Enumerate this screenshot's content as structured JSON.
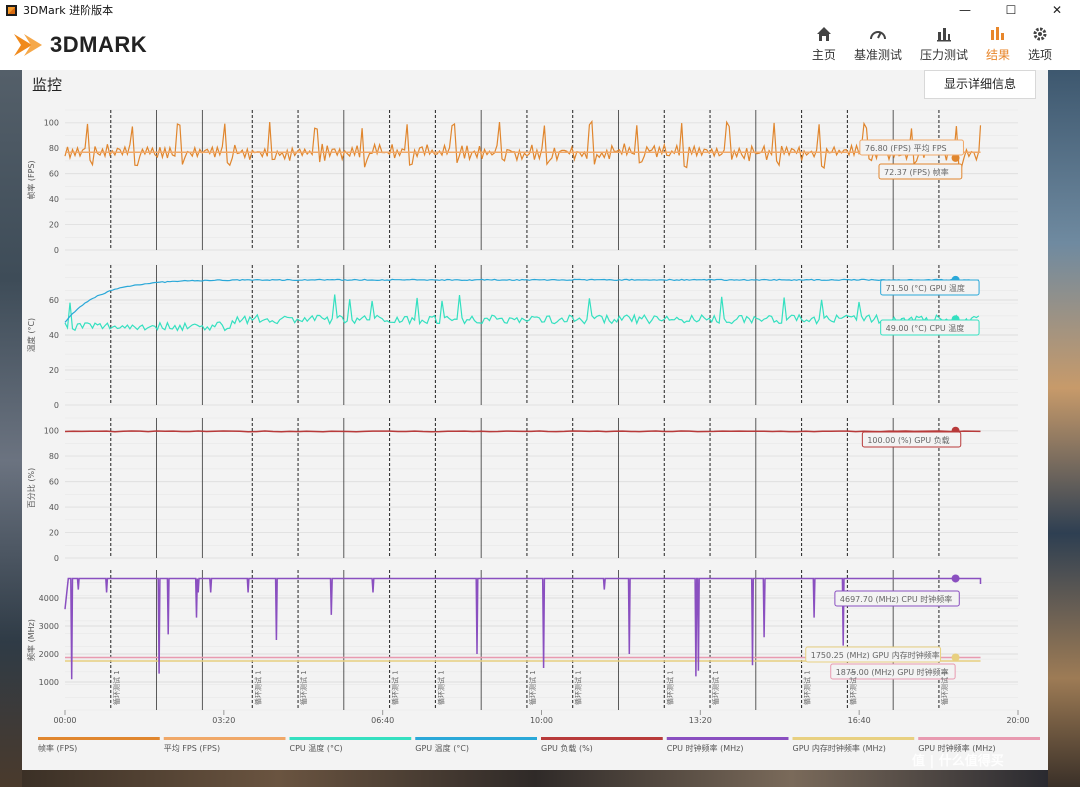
{
  "window": {
    "title": "3DMark 进阶版本",
    "controls": {
      "minimize": "—",
      "maximize": "☐",
      "close": "✕"
    }
  },
  "header": {
    "logo_text": "3DMARK",
    "nav": [
      {
        "label": "主页",
        "icon": "home-icon",
        "active": false
      },
      {
        "label": "基准测试",
        "icon": "gauge-icon",
        "active": false
      },
      {
        "label": "压力测试",
        "icon": "bar-chart-icon",
        "active": false
      },
      {
        "label": "结果",
        "icon": "results-icon",
        "active": true
      },
      {
        "label": "选项",
        "icon": "gear-icon",
        "active": false
      }
    ]
  },
  "monitor": {
    "title": "监控",
    "detail_button": "显示详细信息",
    "loop_marker_label": "循环测试 1",
    "time_ticks": [
      "00:00",
      "03:20",
      "06:40",
      "10:00",
      "13:20",
      "16:40",
      "20:00"
    ]
  },
  "colors": {
    "fps": "#e0862e",
    "avg_fps": "#f0a868",
    "cpu_temp": "#34e0c0",
    "gpu_temp": "#2aa8d8",
    "gpu_load": "#b83a3a",
    "cpu_clock": "#8a4fc0",
    "gpu_mem_clock": "#e8d080",
    "gpu_clock": "#e89ab0"
  },
  "chart_data": [
    {
      "type": "line",
      "ylabel": "帧率 (FPS)",
      "yticks": [
        "100",
        "80",
        "60",
        "40",
        "20",
        "0"
      ],
      "ylim": [
        0,
        110
      ],
      "xlim": [
        0,
        1145
      ],
      "series": [
        {
          "name": "帧率 (FPS)",
          "pattern": "periodic spikes",
          "base": 76.8,
          "last_value": 72.37
        },
        {
          "name": "平均 FPS (FPS)",
          "constant": 76.8
        }
      ],
      "annotations": [
        {
          "text": "76.80 (FPS) 平均 FPS",
          "series": "平均 FPS (FPS)"
        },
        {
          "text": "72.37 (FPS) 帧率",
          "series": "帧率 (FPS)"
        }
      ]
    },
    {
      "type": "line",
      "ylabel": "温度 (°C)",
      "yticks": [
        "60",
        "40",
        "20",
        "0"
      ],
      "ylim": [
        0,
        80
      ],
      "xlim": [
        0,
        1145
      ],
      "series": [
        {
          "name": "GPU 温度 (°C)",
          "start": 47,
          "plateau": 71.5,
          "last_value": 71.5
        },
        {
          "name": "CPU 温度 (°C)",
          "base": 44,
          "noise": 5,
          "last_value": 49.0
        }
      ],
      "annotations": [
        {
          "text": "71.50 (°C) GPU 温度",
          "series": "GPU 温度 (°C)"
        },
        {
          "text": "49.00 (°C) CPU 温度",
          "series": "CPU 温度 (°C)"
        }
      ]
    },
    {
      "type": "line",
      "ylabel": "百分比 (%)",
      "yticks": [
        "100",
        "80",
        "60",
        "40",
        "20",
        "0"
      ],
      "ylim": [
        0,
        110
      ],
      "xlim": [
        0,
        1145
      ],
      "series": [
        {
          "name": "GPU 负载 (%)",
          "constant": 99.5,
          "last_value": 100.0
        }
      ],
      "annotations": [
        {
          "text": "100.00 (%) GPU 负载",
          "series": "GPU 负载 (%)"
        }
      ]
    },
    {
      "type": "line",
      "ylabel": "频率 (MHz)",
      "yticks": [
        "4000",
        "3000",
        "2000",
        "1000"
      ],
      "ylim": [
        0,
        5000
      ],
      "xlim": [
        0,
        1145
      ],
      "series": [
        {
          "name": "CPU 时钟频率 (MHz)",
          "base": 4697.7,
          "last_value": 4697.7,
          "dips": [
            [
              8,
              1100
            ],
            [
              16,
              4300
            ],
            [
              50,
              4200
            ],
            [
              113,
              1300
            ],
            [
              124,
              2700
            ],
            [
              160,
              4200
            ],
            [
              158,
              3300
            ],
            [
              175,
              4200
            ],
            [
              220,
              4200
            ],
            [
              254,
              2500
            ],
            [
              320,
              3400
            ],
            [
              370,
              4200
            ],
            [
              495,
              2000
            ],
            [
              575,
              1500
            ],
            [
              648,
              4300
            ],
            [
              678,
              2000
            ],
            [
              758,
              1200
            ],
            [
              761,
              1400
            ],
            [
              826,
              1600
            ],
            [
              840,
              2600
            ],
            [
              900,
              3300
            ],
            [
              935,
              2300
            ]
          ]
        },
        {
          "name": "GPU 内存时钟频率 (MHz)",
          "constant": 1750.25,
          "last_value": 1750.25
        },
        {
          "name": "GPU 时钟频率 (MHz)",
          "constant": 1875.0,
          "last_value": 1875.0
        }
      ],
      "annotations": [
        {
          "text": "4697.70 (MHz) CPU 时钟频率",
          "series": "CPU 时钟频率 (MHz)"
        },
        {
          "text": "1750.25 (MHz) GPU 内存时钟频率",
          "series": "GPU 内存时钟频率 (MHz)"
        },
        {
          "text": "1875.00 (MHz) GPU 时钟频率",
          "series": "GPU 时钟频率 (MHz)"
        }
      ]
    }
  ],
  "legend": [
    {
      "label": "帧率 (FPS)",
      "color": "#e0862e"
    },
    {
      "label": "平均 FPS (FPS)",
      "color": "#f0a868"
    },
    {
      "label": "CPU 温度 (°C)",
      "color": "#34e0c0"
    },
    {
      "label": "GPU 温度 (°C)",
      "color": "#2aa8d8"
    },
    {
      "label": "GPU 负载 (%)",
      "color": "#b83a3a"
    },
    {
      "label": "CPU 时钟频率 (MHz)",
      "color": "#8a4fc0"
    },
    {
      "label": "GPU 内存时钟频率 (MHz)",
      "color": "#e8d080"
    },
    {
      "label": "GPU 时钟频率 (MHz)",
      "color": "#e89ab0"
    }
  ],
  "watermark": "值 | 什么值得买"
}
